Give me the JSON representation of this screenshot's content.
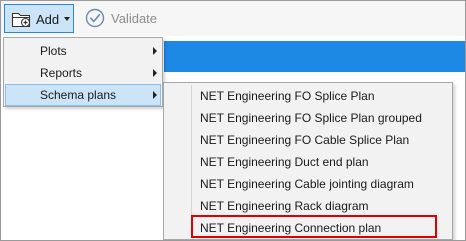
{
  "toolbar": {
    "add_label": "Add",
    "validate_label": "Validate",
    "icons": {
      "add": "folder-add-icon",
      "validate": "check-circle-icon",
      "add_caret": "caret-down-icon"
    }
  },
  "add_menu": {
    "items": [
      {
        "label": "Plots",
        "has_submenu": true,
        "selected": false
      },
      {
        "label": "Reports",
        "has_submenu": true,
        "selected": false
      },
      {
        "label": "Schema plans",
        "has_submenu": true,
        "selected": true
      }
    ]
  },
  "schema_plans_menu": {
    "items": [
      {
        "label": "NET Engineering FO Splice Plan"
      },
      {
        "label": "NET Engineering FO Splice Plan grouped"
      },
      {
        "label": "NET Engineering FO Cable Splice Plan"
      },
      {
        "label": "NET Engineering Duct end plan"
      },
      {
        "label": "NET Engineering Cable jointing diagram"
      },
      {
        "label": "NET Engineering Rack diagram"
      },
      {
        "label": "NET Engineering Connection plan",
        "highlighted": true
      }
    ]
  },
  "colors": {
    "accent_blue": "#1e88e5",
    "selection": "#cce4f7",
    "highlight_outline": "#e00000"
  }
}
